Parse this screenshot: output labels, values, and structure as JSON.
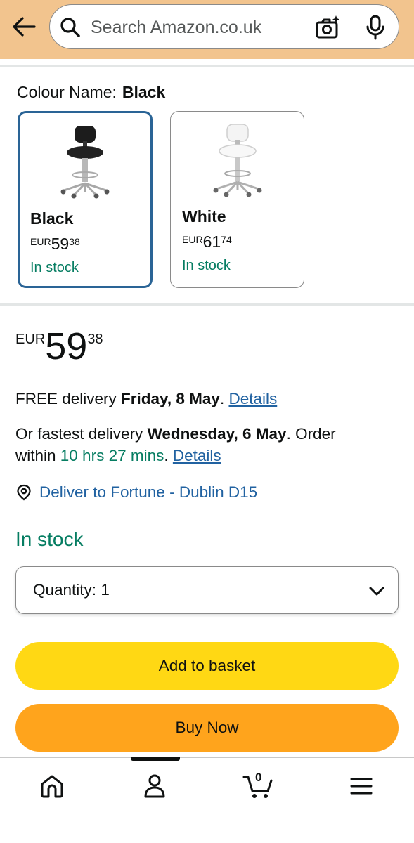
{
  "header": {
    "search_placeholder": "Search Amazon.co.uk",
    "back_icon": "arrow-left-icon",
    "search_icon": "magnifier-icon",
    "camera_icon": "camera-sparkle-icon",
    "mic_icon": "microphone-icon",
    "background_color": "#f2c48e"
  },
  "colour": {
    "label": "Colour Name:",
    "selected_value": "Black",
    "options": [
      {
        "name": "Black",
        "currency": "EUR",
        "whole": "59",
        "fraction": "38",
        "stock": "In stock",
        "selected": true
      },
      {
        "name": "White",
        "currency": "EUR",
        "whole": "61",
        "fraction": "74",
        "stock": "In stock",
        "selected": false
      }
    ]
  },
  "price": {
    "currency": "EUR",
    "whole": "59",
    "fraction": "38"
  },
  "delivery": {
    "free_prefix": "FREE delivery ",
    "free_date": "Friday, 8 May",
    "free_suffix": ". ",
    "details_link": "Details",
    "fastest_prefix": "Or fastest delivery ",
    "fastest_date": "Wednesday, 6 May",
    "fastest_suffix": ". Order",
    "within_prefix": "within ",
    "within_time": "10 hrs 27 mins",
    "within_suffix": ". ",
    "details_link_2": "Details",
    "deliver_to": "Deliver to Fortune - Dublin D15"
  },
  "stock_status": "In stock",
  "quantity": {
    "label": "Quantity:",
    "value": "1"
  },
  "buttons": {
    "add_to_basket": "Add to basket",
    "buy_now": "Buy Now",
    "basket_color": "#ffd814",
    "buy_color": "#ffa41c"
  },
  "bottom_nav": {
    "items": [
      "home-icon",
      "account-icon",
      "cart-icon",
      "menu-icon"
    ],
    "cart_count": "0"
  },
  "colors": {
    "link": "#2162a1",
    "stock_green": "#067d62",
    "selected_border": "#2a6496"
  }
}
